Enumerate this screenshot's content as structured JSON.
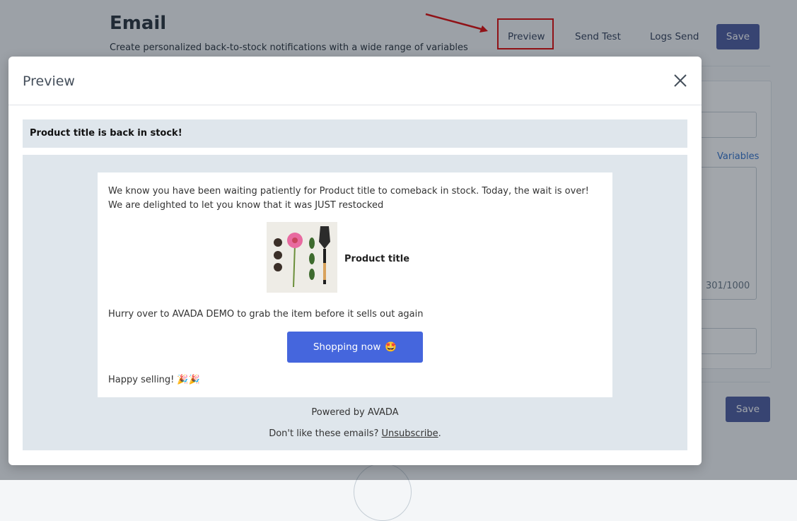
{
  "page": {
    "title": "Email",
    "subtitle": "Create personalized back-to-stock notifications with a wide range of variables",
    "actions": {
      "preview": "Preview",
      "send_test": "Send Test",
      "logs_send": "Logs Send",
      "save": "Save"
    },
    "variables_link": "Variables",
    "char_counter": "301/1000",
    "save_bottom": "Save"
  },
  "colors": {
    "primary_button": "#47569e",
    "shop_button": "#4566dd",
    "highlight": "#e00000",
    "email_bg": "#dfe6ec"
  },
  "modal": {
    "title": "Preview",
    "close_icon": "close-icon",
    "subject": "Product title is back in stock!",
    "email": {
      "intro": "We know you have been waiting patiently for Product title to comeback in stock. Today, the wait is over! We are delighted to let you know that it was JUST restocked",
      "product_name": "Product title",
      "hurry": "Hurry over to AVADA DEMO to grab the item before it sells out again",
      "shop_button": "Shopping now",
      "shop_emoji": "🤩",
      "sign_off": "Happy selling!",
      "sign_off_emoji": "🎉🎉"
    },
    "powered_by": "Powered by AVADA",
    "unsubscribe_prefix": "Don't like these emails? ",
    "unsubscribe_link": "Unsubscribe",
    "unsubscribe_suffix": "."
  }
}
